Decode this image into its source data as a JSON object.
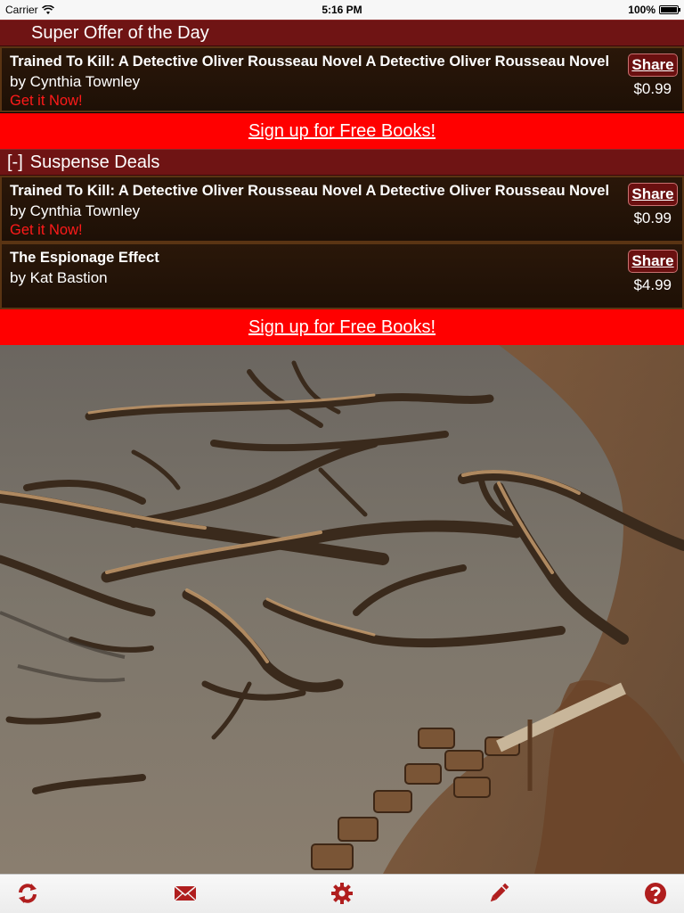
{
  "status_bar": {
    "carrier": "Carrier",
    "time": "5:16 PM",
    "battery": "100%"
  },
  "super_offer": {
    "header": "Super Offer of the Day",
    "book": {
      "title": "Trained To Kill: A Detective Oliver Rousseau Novel A Detective Oliver Rousseau Novel",
      "author": "by Cynthia Townley",
      "cta": "Get it Now!",
      "share": "Share",
      "price": "$0.99"
    }
  },
  "signup_text": "Sign up for Free Books!",
  "suspense": {
    "toggle": "[-]",
    "header": "Suspense Deals",
    "books": [
      {
        "title": "Trained To Kill: A Detective Oliver Rousseau Novel A Detective Oliver Rousseau Novel",
        "author": "by Cynthia Townley",
        "cta": "Get it Now!",
        "share": "Share",
        "price": "$0.99"
      },
      {
        "title": "The Espionage Effect",
        "author": "by Kat Bastion",
        "share": "Share",
        "price": "$4.99"
      }
    ]
  },
  "tab_bar": {
    "icons": [
      "refresh-icon",
      "mail-icon",
      "gear-icon",
      "pencil-icon",
      "help-icon"
    ],
    "accent": "#b01e1e"
  }
}
